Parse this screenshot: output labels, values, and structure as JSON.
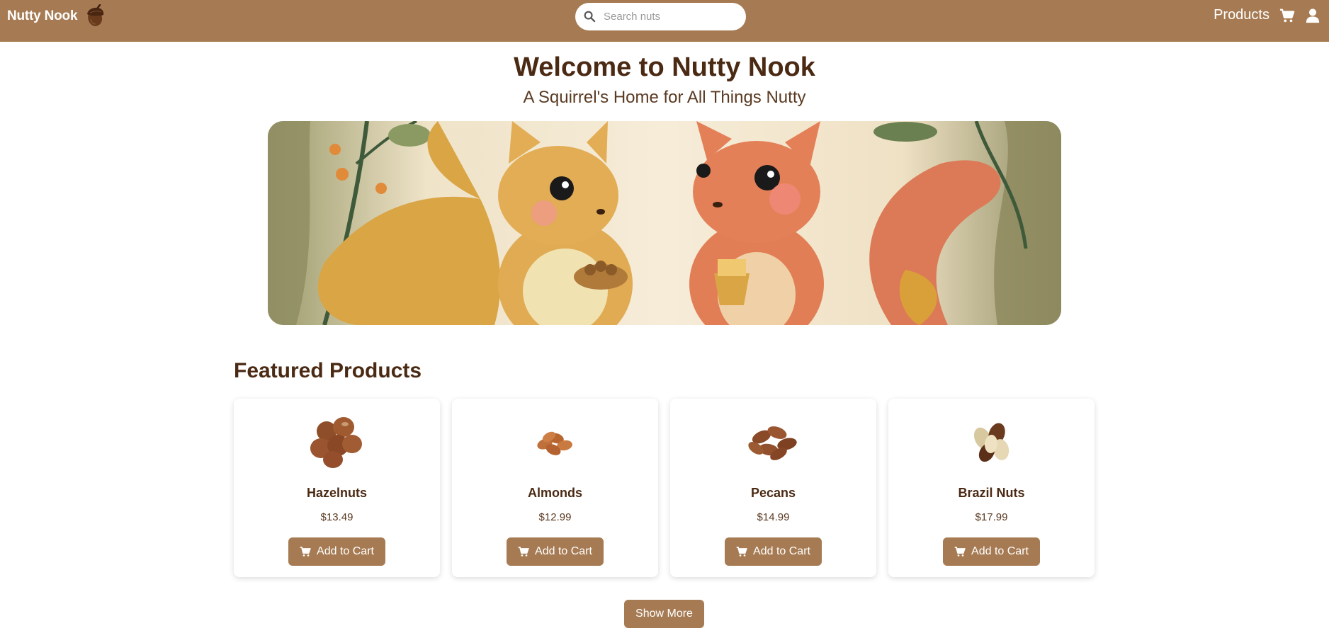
{
  "header": {
    "brand": "Nutty Nook",
    "brand_icon": "acorn-icon",
    "search_placeholder": "Search nuts",
    "nav_products": "Products",
    "cart_icon": "cart-icon",
    "user_icon": "user-icon"
  },
  "hero": {
    "title": "Welcome to Nutty Nook",
    "subtitle": "A Squirrel's Home for All Things Nutty",
    "banner_image": "squirrels-illustration"
  },
  "featured": {
    "title": "Featured Products",
    "products": [
      {
        "name": "Hazelnuts",
        "price": "$13.49",
        "button": "Add to Cart",
        "image": "hazelnuts-image"
      },
      {
        "name": "Almonds",
        "price": "$12.99",
        "button": "Add to Cart",
        "image": "almonds-image"
      },
      {
        "name": "Pecans",
        "price": "$14.99",
        "button": "Add to Cart",
        "image": "pecans-image"
      },
      {
        "name": "Brazil Nuts",
        "price": "$17.99",
        "button": "Add to Cart",
        "image": "brazil-nuts-image"
      }
    ],
    "show_more": "Show More"
  },
  "colors": {
    "header_bg": "#a67b53",
    "heading_text": "#4b2a14",
    "button_bg": "#a67b53",
    "button_text": "#ffffff"
  }
}
